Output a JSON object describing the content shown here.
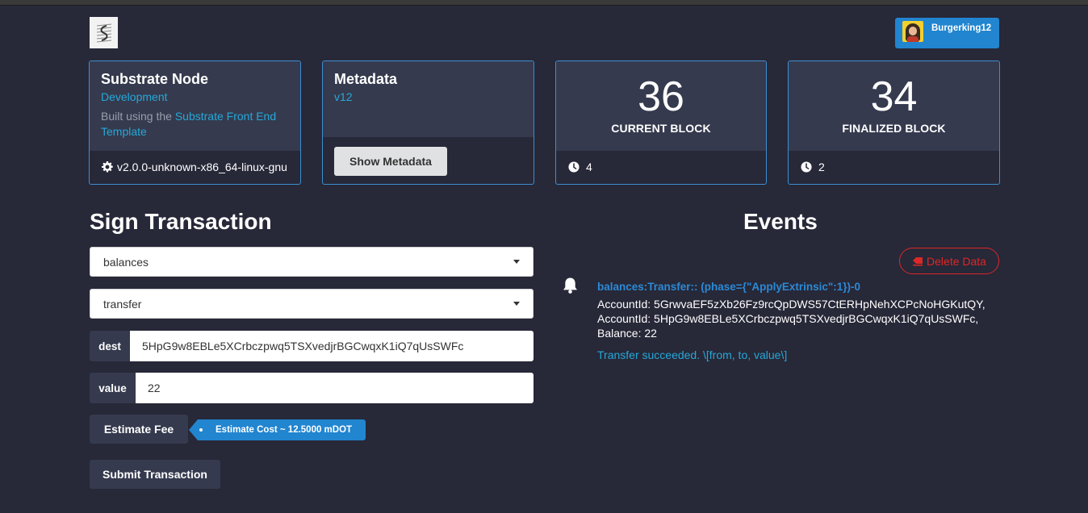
{
  "user": {
    "name": "Burgerking12",
    "avatar_icon": "user-avatar"
  },
  "node": {
    "title": "Substrate Node",
    "chain": "Development",
    "desc_prefix": "Built using the",
    "desc_link": "Substrate Front End Template",
    "version": "v2.0.0-unknown-x86_64-linux-gnu"
  },
  "metadata": {
    "title": "Metadata",
    "version": "v12",
    "button": "Show Metadata"
  },
  "current_block": {
    "number": "36",
    "label": "CURRENT BLOCK",
    "timer": "4"
  },
  "finalized_block": {
    "number": "34",
    "label": "FINALIZED BLOCK",
    "timer": "2"
  },
  "sign_tx": {
    "title": "Sign Transaction",
    "pallet": "balances",
    "call": "transfer",
    "params": [
      {
        "label": "dest",
        "value": "5HpG9w8EBLe5XCrbczpwq5TSXvedjrBGCwqxK1iQ7qUsSWFc"
      },
      {
        "label": "value",
        "value": "22"
      }
    ],
    "estimate_button": "Estimate Fee",
    "estimate_result": "Estimate Cost ~ 12.5000 mDOT",
    "submit_button": "Submit Transaction"
  },
  "events": {
    "title": "Events",
    "delete_button": "Delete Data",
    "items": [
      {
        "title": "balances:Transfer:: (phase={\"ApplyExtrinsic\":1})-0",
        "lines": [
          "AccountId: 5GrwvaEF5zXb26Fz9rcQpDWS57CtERHpNehXCPcNoHGKutQY,",
          "AccountId: 5HpG9w8EBLe5XCrbczpwq5TSXvedjrBGCwqxK1iQ7qUsSWFc,",
          "Balance: 22"
        ],
        "doc": "Transfer succeeded. \\[from, to, value\\]"
      }
    ]
  },
  "colors": {
    "background": "#272838",
    "card": "#353a4e",
    "accent": "#2185d0",
    "link": "#26a8d8",
    "danger": "#db2828"
  }
}
